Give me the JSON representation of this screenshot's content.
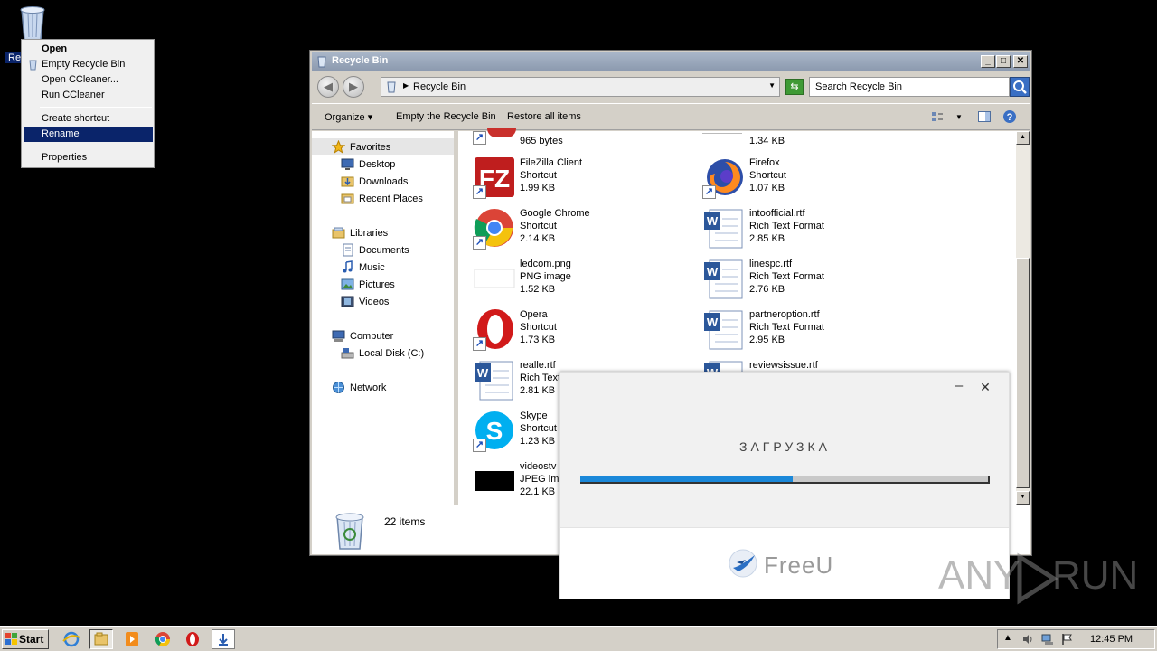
{
  "desktop": {
    "recycle_label": "Re"
  },
  "context_menu": {
    "items": [
      {
        "label": "Open"
      },
      {
        "label": "Empty Recycle Bin"
      },
      {
        "label": "Open CCleaner..."
      },
      {
        "label": "Run CCleaner"
      },
      {
        "label": "Create shortcut"
      },
      {
        "label": "Rename"
      },
      {
        "label": "Properties"
      }
    ]
  },
  "window": {
    "title": "Recycle Bin",
    "minimize": "_",
    "maximize": "□",
    "close": "✕",
    "address": "Recycle Bin",
    "search_placeholder": "Search Recycle Bin",
    "toolbar": {
      "organize": "Organize",
      "empty": "Empty the Recycle Bin",
      "restore": "Restore all items"
    },
    "nav": {
      "favorites": "Favorites",
      "desktop": "Desktop",
      "downloads": "Downloads",
      "recent": "Recent Places",
      "libraries": "Libraries",
      "documents": "Documents",
      "music": "Music",
      "pictures": "Pictures",
      "videos": "Videos",
      "computer": "Computer",
      "local_disk": "Local Disk (C:)",
      "network": "Network"
    },
    "files": [
      {
        "name": "",
        "type": "",
        "size": "965 bytes"
      },
      {
        "name": "",
        "type": "",
        "size": "1.34 KB"
      },
      {
        "name": "FileZilla Client",
        "type": "Shortcut",
        "size": "1.99 KB"
      },
      {
        "name": "Firefox",
        "type": "Shortcut",
        "size": "1.07 KB"
      },
      {
        "name": "Google Chrome",
        "type": "Shortcut",
        "size": "2.14 KB"
      },
      {
        "name": "intoofficial.rtf",
        "type": "Rich Text Format",
        "size": "2.85 KB"
      },
      {
        "name": "ledcom.png",
        "type": "PNG image",
        "size": "1.52 KB"
      },
      {
        "name": "linespc.rtf",
        "type": "Rich Text Format",
        "size": "2.76 KB"
      },
      {
        "name": "Opera",
        "type": "Shortcut",
        "size": "1.73 KB"
      },
      {
        "name": "partneroption.rtf",
        "type": "Rich Text Format",
        "size": "2.95 KB"
      },
      {
        "name": "realle.rtf",
        "type": "Rich Text",
        "size": "2.81 KB"
      },
      {
        "name": "reviewsissue.rtf",
        "type": "",
        "size": ""
      },
      {
        "name": "Skype",
        "type": "Shortcut",
        "size": "1.23 KB"
      },
      {
        "name": "videostv",
        "type": "JPEG ima",
        "size": "22.1 KB"
      }
    ],
    "item_count": "22 items"
  },
  "loader": {
    "title": "ЗАГРУЗКА",
    "progress": 0.52,
    "brand": "FreeU",
    "min": "–",
    "close": "✕"
  },
  "watermark": {
    "left": "ANY",
    "right": "RUN"
  },
  "taskbar": {
    "start": "Start",
    "clock": "12:45 PM"
  },
  "colors": {
    "selection": "#0a246a",
    "progress": "#1b88d9"
  }
}
